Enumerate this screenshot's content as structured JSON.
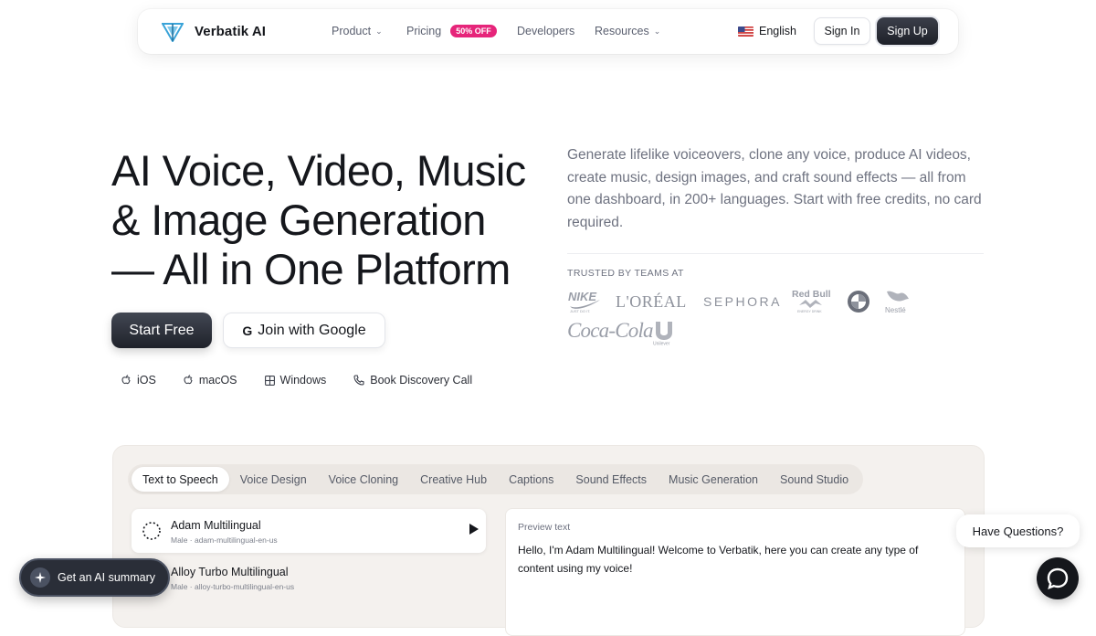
{
  "nav": {
    "brand": "Verbatik AI",
    "product": "Product",
    "pricing": "Pricing",
    "pricing_badge": "50% OFF",
    "developers": "Developers",
    "resources": "Resources",
    "language": "English",
    "sign_in": "Sign In",
    "sign_up": "Sign Up",
    "accent_color": "#e6257a"
  },
  "hero": {
    "title_lines": [
      "AI Voice, Video, Music",
      "& Image Generation",
      "— All in One Platform"
    ],
    "start_free": "Start Free",
    "join_google": "Join with Google",
    "platforms": [
      "iOS",
      "macOS",
      "Windows",
      "Book Discovery Call"
    ],
    "description": "Generate lifelike voiceovers, clone any voice, produce AI videos, create music, design images, and craft sound effects — all from one dashboard, in 200+ languages. Start with free credits, no card required.",
    "trusted_label": "TRUSTED BY TEAMS AT",
    "logos": [
      "NIKE",
      "L'ORÉAL",
      "SEPHORA",
      "Red Bull",
      "BMW",
      "Nestlé",
      "Coca-Cola",
      "Unilever"
    ]
  },
  "demo": {
    "tabs": [
      "Text to Speech",
      "Voice Design",
      "Voice Cloning",
      "Creative Hub",
      "Captions",
      "Sound Effects",
      "Music Generation",
      "Sound Studio"
    ],
    "active_tab": "Text to Speech",
    "voices": [
      {
        "name": "Adam Multilingual",
        "meta": "Male · adam-multilingual-en-us"
      },
      {
        "name": "Alloy Turbo Multilingual",
        "meta": "Male · alloy-turbo-multilingual-en-us"
      }
    ],
    "preview_label": "Preview text",
    "preview_text": "Hello, I'm Adam Multilingual! Welcome to Verbatik, here you can create any type of content using my voice!"
  },
  "floating": {
    "ai_summary": "Get an AI summary",
    "have_questions": "Have Questions?"
  }
}
